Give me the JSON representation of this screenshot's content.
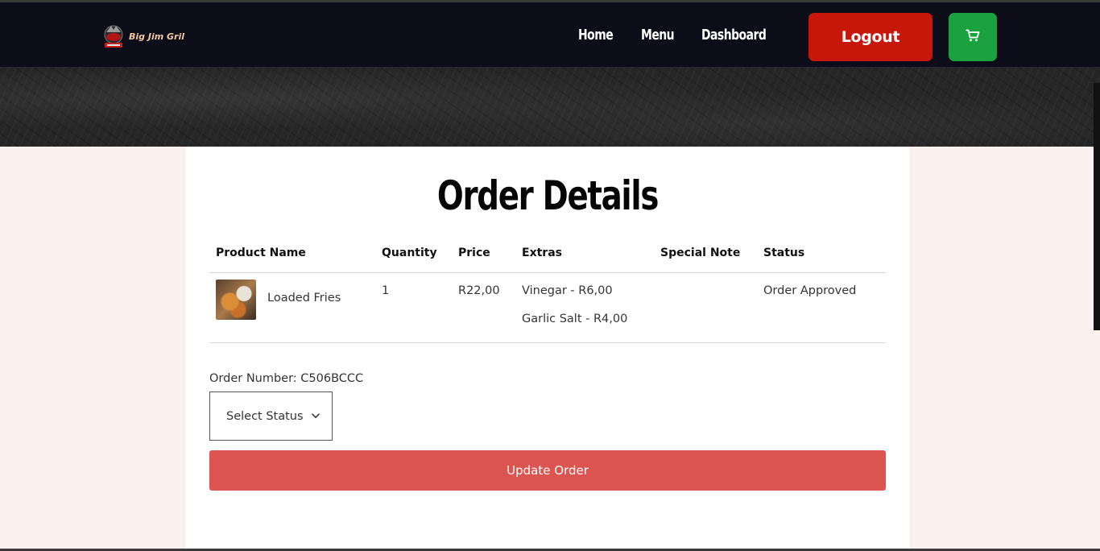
{
  "nav": {
    "logo_text": "Big Jim Gril",
    "links": [
      "Home",
      "Menu",
      "Dashboard"
    ],
    "logout_label": "Logout",
    "cart_icon": "cart-icon"
  },
  "order": {
    "title": "Order Details",
    "columns": [
      "Product Name",
      "Quantity",
      "Price",
      "Extras",
      "Special Note",
      "Status"
    ],
    "rows": [
      {
        "product": "Loaded Fries",
        "quantity": "1",
        "price": "R22,00",
        "extras": [
          "Vinegar - R6,00",
          "Garlic Salt - R4,00"
        ],
        "special_note": "",
        "status": "Order Approved"
      }
    ],
    "order_number_text": "Order Number: C506BCCC",
    "status_select": {
      "selected": "Select Status",
      "icon": "chevron-down-icon"
    },
    "update_label": "Update Order"
  },
  "colors": {
    "nav_bg": "#0d0d1a",
    "logout_bg": "#c7170b",
    "cart_bg": "#1aa23f",
    "update_bg": "#dc5450",
    "page_bg": "#fbf1ef"
  }
}
